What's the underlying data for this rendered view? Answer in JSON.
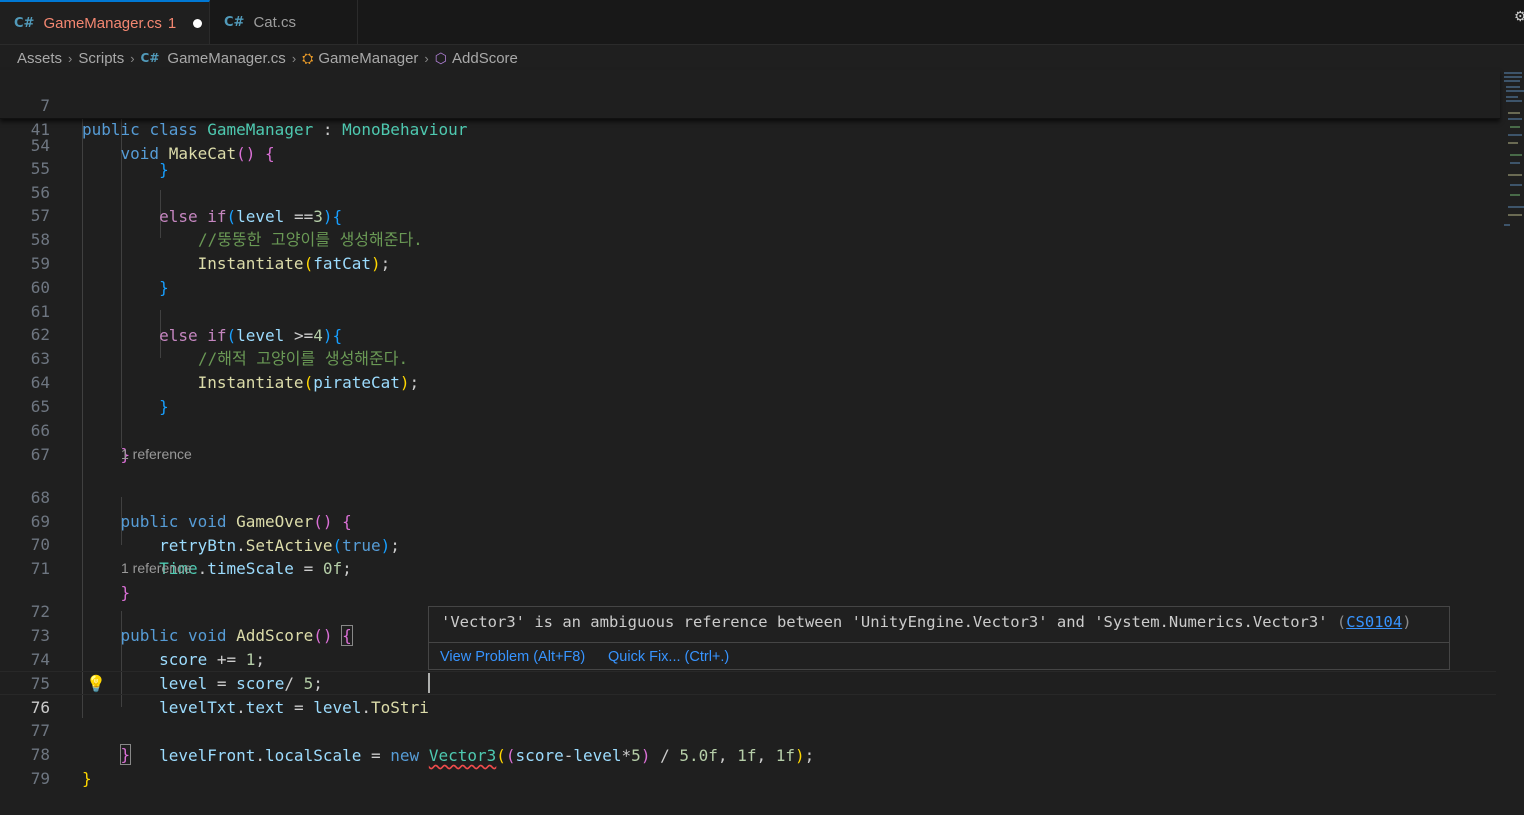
{
  "tabs": [
    {
      "label": "GameManager.cs",
      "problems": "1",
      "icon": "csharp-icon"
    },
    {
      "label": "Cat.cs",
      "icon": "csharp-icon"
    }
  ],
  "breadcrumb": [
    "Assets",
    "Scripts",
    "GameManager.cs",
    "GameManager",
    "AddScore"
  ],
  "sticky": [
    {
      "n": "7",
      "code": "public class GameManager : MonoBehaviour"
    },
    {
      "n": "41",
      "code": "void MakeCat() {"
    }
  ],
  "lines": [
    {
      "n": "54",
      "code": "}"
    },
    {
      "n": "55",
      "code": ""
    },
    {
      "n": "56",
      "code": "else if(level ==3){"
    },
    {
      "n": "57",
      "code": "//뚱뚱한 고양이를 생성해준다."
    },
    {
      "n": "58",
      "code": "Instantiate(fatCat);"
    },
    {
      "n": "59",
      "code": "}"
    },
    {
      "n": "60",
      "code": ""
    },
    {
      "n": "61",
      "code": "else if(level >=4){"
    },
    {
      "n": "62",
      "code": "//해적 고양이를 생성해준다."
    },
    {
      "n": "63",
      "code": "Instantiate(pirateCat);"
    },
    {
      "n": "64",
      "code": "}"
    },
    {
      "n": "65",
      "code": ""
    },
    {
      "n": "66",
      "code": "}"
    },
    {
      "n": "67",
      "code": ""
    },
    {
      "n": "68",
      "code": "public void GameOver() {"
    },
    {
      "n": "69",
      "code": "retryBtn.SetActive(true);"
    },
    {
      "n": "70",
      "code": "Time.timeScale = 0f;"
    },
    {
      "n": "71",
      "code": "}"
    },
    {
      "n": "72",
      "code": "public void AddScore() {"
    },
    {
      "n": "73",
      "code": "score += 1;"
    },
    {
      "n": "74",
      "code": "level = score/ 5;"
    },
    {
      "n": "75",
      "code": "levelTxt.text = level.ToStri"
    },
    {
      "n": "76",
      "code": "levelFront.localScale = new Vector3((score-level*5) / 5.0f, 1f, 1f);"
    },
    {
      "n": "77",
      "code": "}"
    },
    {
      "n": "78",
      "code": "}"
    },
    {
      "n": "79",
      "code": ""
    }
  ],
  "codelens": [
    "1 reference",
    "1 reference"
  ],
  "hover": {
    "message": "'Vector3' is an ambiguous reference between 'UnityEngine.Vector3' and 'System.Numerics.Vector3'",
    "code": "CS0104",
    "view_problem": "View Problem (Alt+F8)",
    "quick_fix": "Quick Fix... (Ctrl+.)"
  },
  "colors": {
    "accent": "#0078d4",
    "error_tab": "#f48771",
    "link": "#3794ff",
    "squiggle": "#f14c4c"
  }
}
